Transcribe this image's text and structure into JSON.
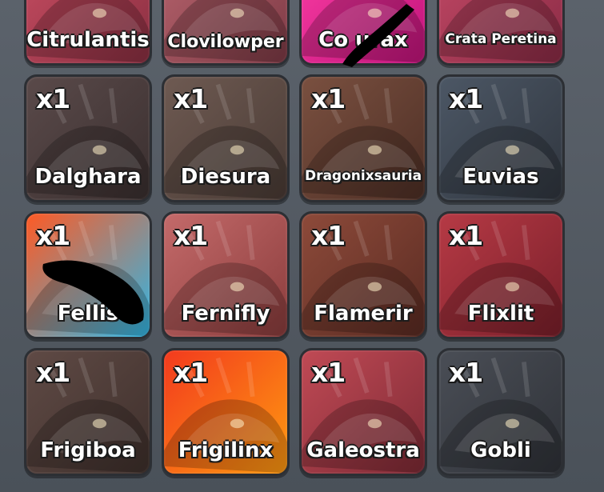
{
  "creatures": [
    {
      "name": "Citrulantis",
      "qty": "",
      "bg": [
        "#c94e63",
        "#8a2f41"
      ],
      "size": ""
    },
    {
      "name": "Clovilowper",
      "qty": "",
      "bg": [
        "#b9656f",
        "#7d3a45"
      ],
      "size": "mid"
    },
    {
      "name": "Co   urax",
      "qty": "",
      "bg": [
        "#ff3fa6",
        "#c0137a"
      ],
      "size": ""
    },
    {
      "name": "Crata Peretina",
      "qty": "",
      "bg": [
        "#c44a67",
        "#8a2b45"
      ],
      "size": "small"
    },
    {
      "name": "Dalghara",
      "qty": "x1",
      "bg": [
        "#5a4a4a",
        "#3a2f2f"
      ],
      "size": ""
    },
    {
      "name": "Diesura",
      "qty": "x1",
      "bg": [
        "#6e5a52",
        "#4a3b35"
      ],
      "size": ""
    },
    {
      "name": "Dragonixsauria",
      "qty": "x1",
      "bg": [
        "#7a5040",
        "#4e2f25"
      ],
      "size": "small"
    },
    {
      "name": "Euvias",
      "qty": "x1",
      "bg": [
        "#4c5765",
        "#30363f"
      ],
      "size": ""
    },
    {
      "name": "Fellis",
      "qty": "x1",
      "bg": [
        "#ff5a24",
        "#2fb7e6"
      ],
      "size": ""
    },
    {
      "name": "Fernifly",
      "qty": "x1",
      "bg": [
        "#c46a6a",
        "#8a3c3c"
      ],
      "size": ""
    },
    {
      "name": "Flamerir",
      "qty": "x1",
      "bg": [
        "#8d4a3a",
        "#5a2b22"
      ],
      "size": ""
    },
    {
      "name": "Flixlit",
      "qty": "x1",
      "bg": [
        "#b63a45",
        "#7a1f2a"
      ],
      "size": ""
    },
    {
      "name": "Frigiboa",
      "qty": "x1",
      "bg": [
        "#5f4a45",
        "#3f302c"
      ],
      "size": ""
    },
    {
      "name": "Frigilinx",
      "qty": "x1",
      "bg": [
        "#f23a1e",
        "#ff9a10"
      ],
      "size": ""
    },
    {
      "name": "Galeostra",
      "qty": "x1",
      "bg": [
        "#c04a55",
        "#7e2a35"
      ],
      "size": ""
    },
    {
      "name": "Gobli",
      "qty": "x1",
      "bg": [
        "#4a4e56",
        "#2f3238"
      ],
      "size": ""
    }
  ]
}
